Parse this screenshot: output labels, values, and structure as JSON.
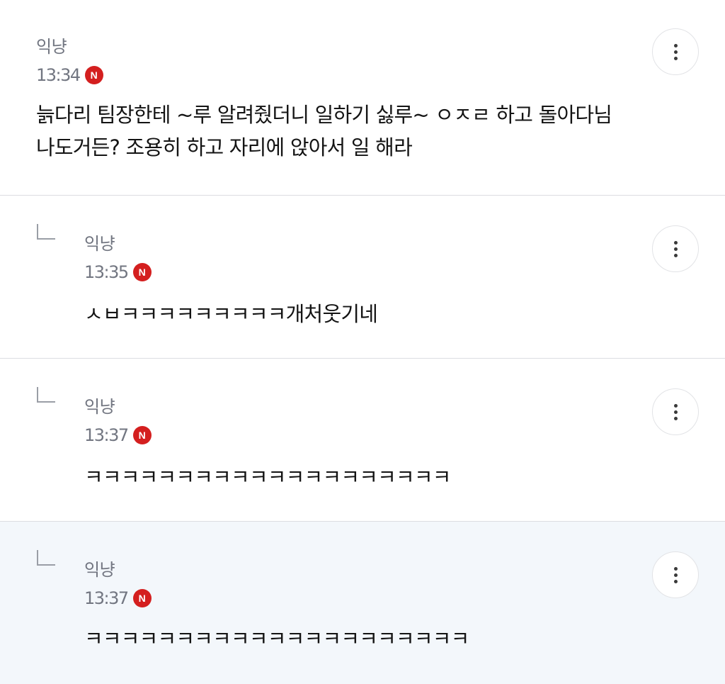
{
  "badge_label": "N",
  "colors": {
    "new_badge": "#d41f1f",
    "highlight_background": "#f3f7fb",
    "meta_text": "#727681",
    "divider": "#dcdde1"
  },
  "icons": {
    "more": "more-vertical-icon",
    "reply": "reply-arrow-icon",
    "new": "new-badge-icon"
  },
  "comments": [
    {
      "author": "익냥",
      "time": "13:34",
      "is_new": true,
      "is_reply": false,
      "lines": [
        "늙다리 팀장한테 ~루 알려줬더니 일하기 싫루~ ㅇㅈㄹ 하고 돌아다님",
        "나도거든? 조용히 하고 자리에 앉아서 일 해라"
      ]
    },
    {
      "author": "익냥",
      "time": "13:35",
      "is_new": true,
      "is_reply": true,
      "lines": [
        "ㅅㅂㅋㅋㅋㅋㅋㅋㅋㅋㅋ개처웃기네"
      ]
    },
    {
      "author": "익냥",
      "time": "13:37",
      "is_new": true,
      "is_reply": true,
      "lines": [
        "ㅋㅋㅋㅋㅋㅋㅋㅋㅋㅋㅋㅋㅋㅋㅋㅋㅋㅋㅋㅋ"
      ]
    },
    {
      "author": "익냥",
      "time": "13:37",
      "is_new": true,
      "is_reply": true,
      "highlighted": true,
      "lines": [
        "ㅋㅋㅋㅋㅋㅋㅋㅋㅋㅋㅋㅋㅋㅋㅋㅋㅋㅋㅋㅋㅋ"
      ]
    }
  ]
}
